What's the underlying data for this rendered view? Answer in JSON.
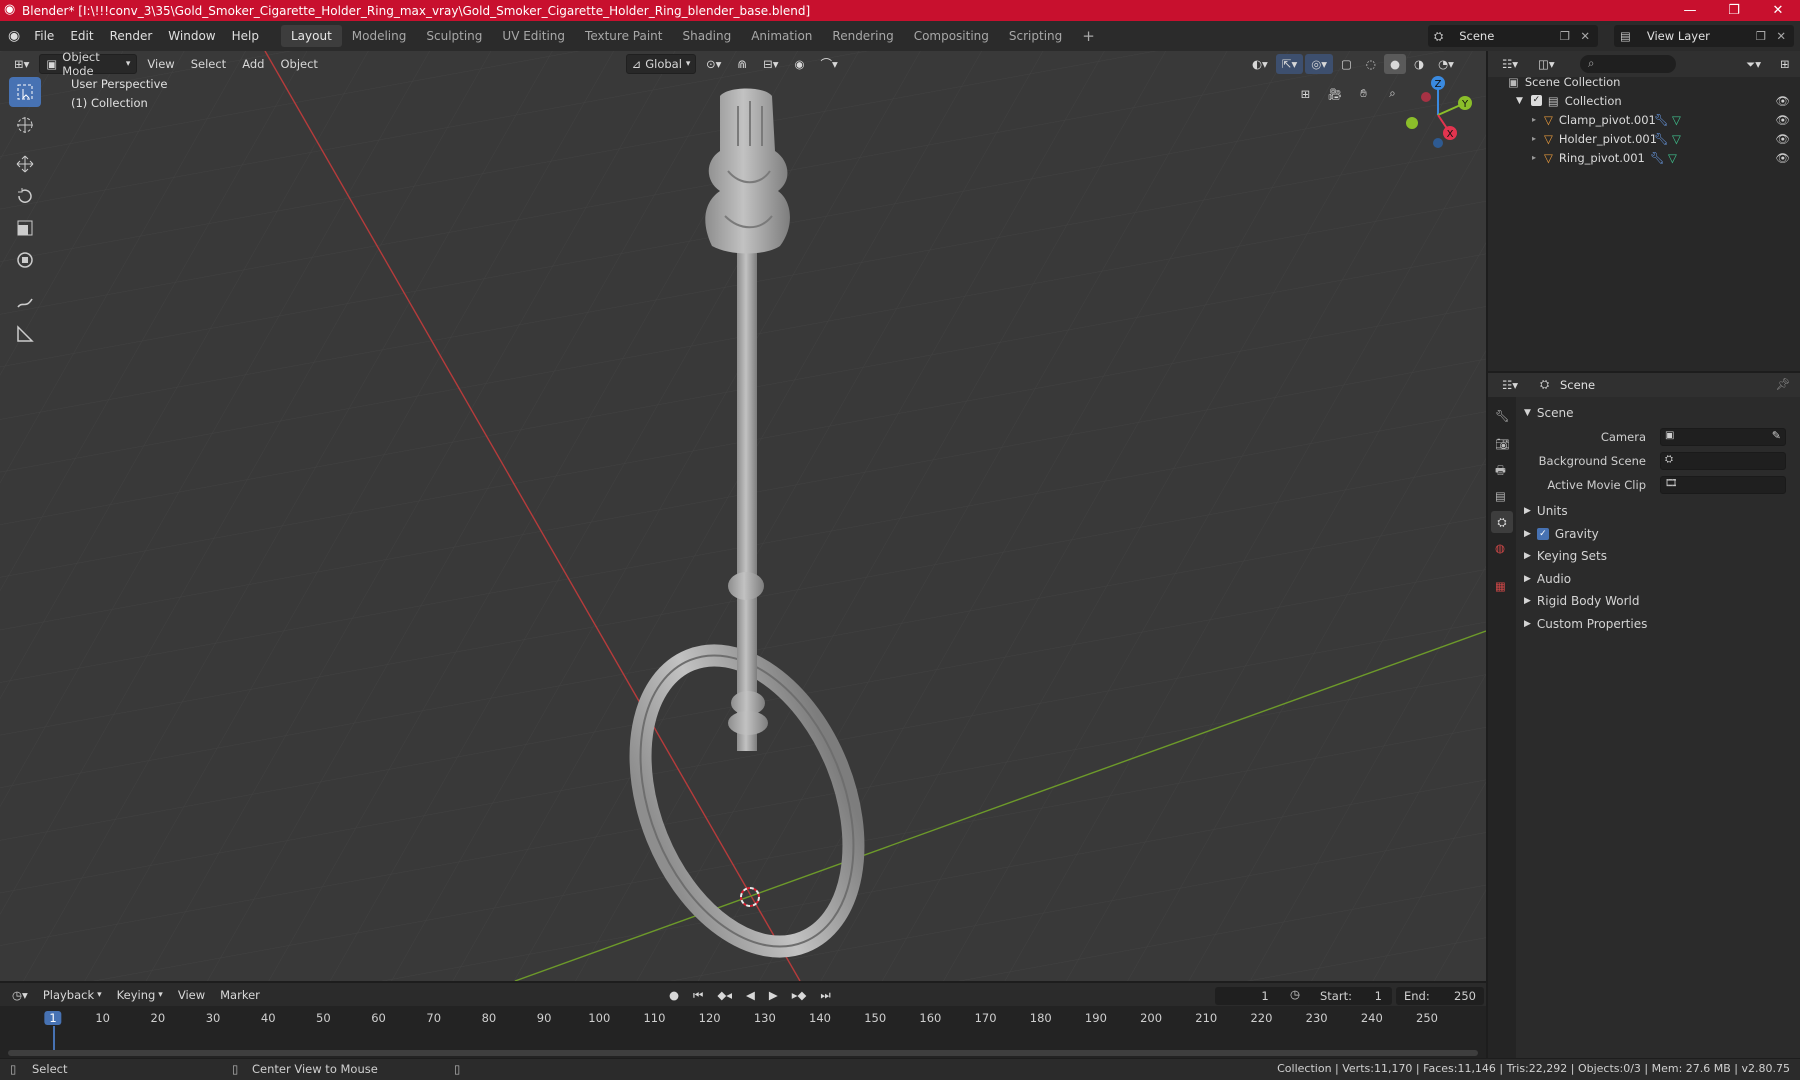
{
  "window": {
    "title": "Blender* [I:\\!!!conv_3\\35\\Gold_Smoker_Cigarette_Holder_Ring_max_vray\\Gold_Smoker_Cigarette_Holder_Ring_blender_base.blend]"
  },
  "menu": {
    "items": [
      "File",
      "Edit",
      "Render",
      "Window",
      "Help"
    ]
  },
  "workspaces": [
    "Layout",
    "Modeling",
    "Sculpting",
    "UV Editing",
    "Texture Paint",
    "Shading",
    "Animation",
    "Rendering",
    "Compositing",
    "Scripting"
  ],
  "active_workspace": "Layout",
  "scene_selector": {
    "value": "Scene"
  },
  "view_layer_selector": {
    "value": "View Layer"
  },
  "viewport_header": {
    "mode": "Object Mode",
    "menus": [
      "View",
      "Select",
      "Add",
      "Object"
    ],
    "orientation": "Global"
  },
  "viewport": {
    "perspective_label": "User Perspective",
    "collection_label": "(1) Collection",
    "gizmo_axes": {
      "x": "X",
      "y": "Y",
      "z": "Z"
    }
  },
  "outliner": {
    "root": "Scene Collection",
    "collection": "Collection",
    "objects": [
      {
        "name": "Clamp_pivot.001"
      },
      {
        "name": "Holder_pivot.001"
      },
      {
        "name": "Ring_pivot.001"
      }
    ]
  },
  "properties": {
    "header_title": "Scene",
    "section": "Scene",
    "fields": [
      {
        "label": "Camera"
      },
      {
        "label": "Background Scene"
      },
      {
        "label": "Active Movie Clip"
      }
    ],
    "panels": [
      "Units",
      "Gravity",
      "Keying Sets",
      "Audio",
      "Rigid Body World",
      "Custom Properties"
    ],
    "gravity_checked": true
  },
  "timeline": {
    "menus": [
      "Playback",
      "Keying",
      "View",
      "Marker"
    ],
    "current_frame": "1",
    "start_label": "Start:",
    "start": "1",
    "end_label": "End:",
    "end": "250",
    "ticks": [
      "1",
      "10",
      "20",
      "30",
      "40",
      "50",
      "60",
      "70",
      "80",
      "90",
      "100",
      "110",
      "120",
      "130",
      "140",
      "150",
      "160",
      "170",
      "180",
      "190",
      "200",
      "210",
      "220",
      "230",
      "240",
      "250"
    ]
  },
  "statusbar": {
    "select": "Select",
    "center_view": "Center View to Mouse",
    "stats": "Collection | Verts:11,170 | Faces:11,146 | Tris:22,292 | Objects:0/3 | Mem: 27.6 MB | v2.80.75"
  },
  "colors": {
    "title_bar": "#c8102e",
    "accent": "#4772b3",
    "axis_x": "#e2344f",
    "axis_y": "#8bbe2a",
    "axis_z": "#3a8ae0",
    "object_icon": "#e89a3c"
  }
}
